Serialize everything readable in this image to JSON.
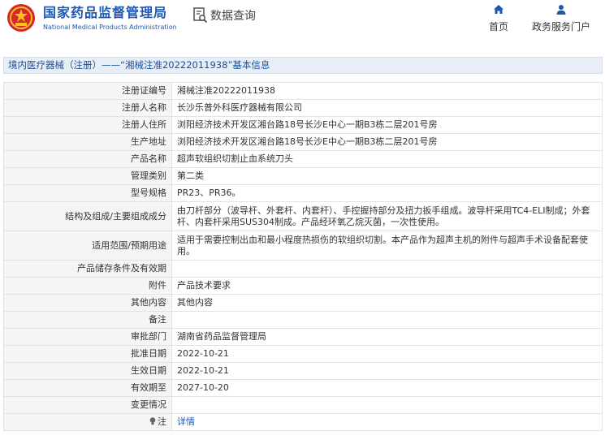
{
  "header": {
    "brand_cn": "国家药品监督管理局",
    "brand_en": "National Medical Products Administration",
    "query_label": "数据查询",
    "nav": [
      {
        "label": "首页",
        "icon": "home-icon"
      },
      {
        "label": "政务服务门户",
        "icon": "user-icon"
      }
    ]
  },
  "breadcrumb": "境内医疗器械（注册）——“湘械注准20222011938”基本信息",
  "rows": [
    {
      "key": "注册证编号",
      "value": "湘械注准20222011938"
    },
    {
      "key": "注册人名称",
      "value": "长沙乐普外科医疗器械有限公司"
    },
    {
      "key": "注册人住所",
      "value": "浏阳经济技术开发区湘台路18号长沙E中心一期B3栋二层201号房"
    },
    {
      "key": "生产地址",
      "value": "浏阳经济技术开发区湘台路18号长沙E中心一期B3栋二层201号房"
    },
    {
      "key": "产品名称",
      "value": "超声软组织切割止血系统刀头"
    },
    {
      "key": "管理类别",
      "value": "第二类"
    },
    {
      "key": "型号规格",
      "value": "PR23、PR36。"
    },
    {
      "key": "结构及组成/主要组成成分",
      "value": "由刀杆部分（波导杆、外套杆、内套杆）、手控握持部分及扭力扳手组成。波导杆采用TC4-ELI制成；外套杆、内套杆采用SUS304制成。产品经环氧乙烷灭菌，一次性使用。"
    },
    {
      "key": "适用范围/预期用途",
      "value": "适用于需要控制出血和最小程度热损伤的软组织切割。本产品作为超声主机的附件与超声手术设备配套使用。"
    },
    {
      "key": "产品储存条件及有效期",
      "value": ""
    },
    {
      "key": "附件",
      "value": "产品技术要求"
    },
    {
      "key": "其他内容",
      "value": "其他内容"
    },
    {
      "key": "备注",
      "value": ""
    },
    {
      "key": "审批部门",
      "value": "湖南省药品监督管理局"
    },
    {
      "key": "批准日期",
      "value": "2022-10-21"
    },
    {
      "key": "生效日期",
      "value": "2022-10-21"
    },
    {
      "key": "有效期至",
      "value": "2027-10-20"
    },
    {
      "key": "变更情况",
      "value": ""
    },
    {
      "key": "注",
      "value": "详情",
      "icon": "bulb-icon"
    }
  ],
  "colors": {
    "brand_blue": "#1d58b3",
    "label_bg": "#f5f5f5",
    "crumb_bg": "#e8eef5"
  }
}
